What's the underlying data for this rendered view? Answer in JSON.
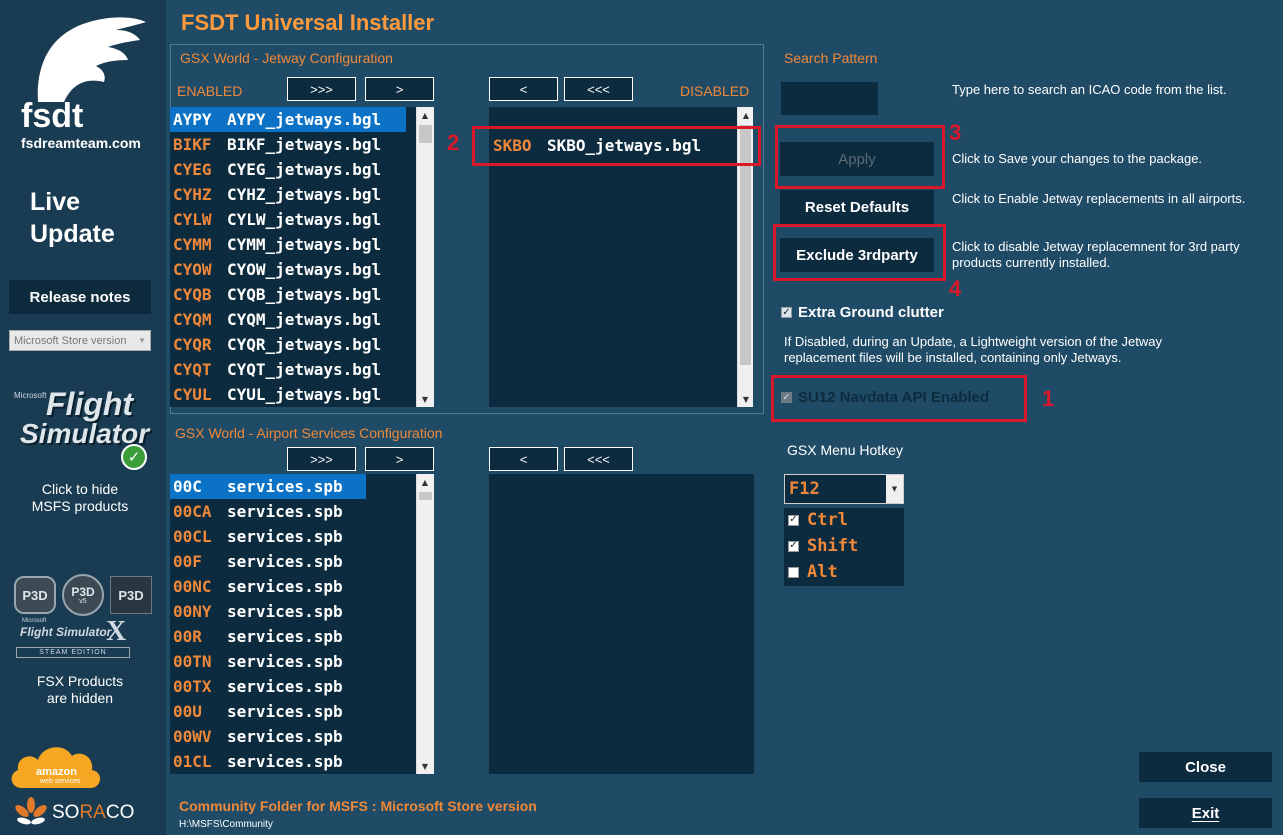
{
  "sidebar": {
    "logo_text": "fsdt",
    "logo_site": "fsdreamteam.com",
    "live_update_line1": "Live",
    "live_update_line2": "Update",
    "release_notes": "Release notes",
    "store_select": "Microsoft Store version",
    "msfs_caption_line1": "Click to hide",
    "msfs_caption_line2": "MSFS products",
    "msfs_logo_line1": "Flight",
    "msfs_logo_line2": "Simulator",
    "msfs_logo_small": "Microsoft",
    "p3d_labels": [
      "P3D",
      "P3D",
      "P3D"
    ],
    "p3d_v5": "v5",
    "fsx_logo_small": "Microsoft",
    "fsx_logo_text": "Flight Simulator",
    "fsx_logo_x": "X",
    "fsx_logo_steam": "STEAM EDITION",
    "fsx_caption_line1": "FSX Products",
    "fsx_caption_line2": "are hidden",
    "aws_label": "amazon",
    "aws_sub": "web services",
    "soraco_pre": "SO",
    "soraco_mid": "RA",
    "soraco_post": "CO"
  },
  "main": {
    "title": "FSDT Universal Installer",
    "jetway_section": "GSX World - Jetway Configuration",
    "enabled_label": "ENABLED",
    "disabled_label": "DISABLED",
    "btn_add_all": ">>>",
    "btn_add": ">",
    "btn_remove": "<",
    "btn_remove_all": "<<<",
    "jetway_enabled": [
      {
        "code": "AYPY",
        "file": "AYPY_jetways.bgl"
      },
      {
        "code": "BIKF",
        "file": "BIKF_jetways.bgl"
      },
      {
        "code": "CYEG",
        "file": "CYEG_jetways.bgl"
      },
      {
        "code": "CYHZ",
        "file": "CYHZ_jetways.bgl"
      },
      {
        "code": "CYLW",
        "file": "CYLW_jetways.bgl"
      },
      {
        "code": "CYMM",
        "file": "CYMM_jetways.bgl"
      },
      {
        "code": "CYOW",
        "file": "CYOW_jetways.bgl"
      },
      {
        "code": "CYQB",
        "file": "CYQB_jetways.bgl"
      },
      {
        "code": "CYQM",
        "file": "CYQM_jetways.bgl"
      },
      {
        "code": "CYQR",
        "file": "CYQR_jetways.bgl"
      },
      {
        "code": "CYQT",
        "file": "CYQT_jetways.bgl"
      },
      {
        "code": "CYUL",
        "file": "CYUL_jetways.bgl"
      }
    ],
    "jetway_disabled": [
      {
        "code": "SKBO",
        "file": "SKBO_jetways.bgl"
      }
    ],
    "services_section": "GSX World - Airport Services Configuration",
    "services_enabled": [
      {
        "code": "00C",
        "file": "services.spb"
      },
      {
        "code": "00CA",
        "file": "services.spb"
      },
      {
        "code": "00CL",
        "file": "services.spb"
      },
      {
        "code": "00F",
        "file": "services.spb"
      },
      {
        "code": "00NC",
        "file": "services.spb"
      },
      {
        "code": "00NY",
        "file": "services.spb"
      },
      {
        "code": "00R",
        "file": "services.spb"
      },
      {
        "code": "00TN",
        "file": "services.spb"
      },
      {
        "code": "00TX",
        "file": "services.spb"
      },
      {
        "code": "00U",
        "file": "services.spb"
      },
      {
        "code": "00WV",
        "file": "services.spb"
      },
      {
        "code": "01CL",
        "file": "services.spb"
      }
    ],
    "search_pattern_label": "Search Pattern",
    "search_value": "",
    "search_help": "Type here to search an ICAO code from the list.",
    "apply_label": "Apply",
    "apply_help": "Click to Save your changes to the package.",
    "reset_label": "Reset Defaults",
    "reset_help": "Click to Enable Jetway replacements in all airports.",
    "exclude_label": "Exclude 3rdparty",
    "exclude_help": "Click to disable Jetway replacemnent for 3rd party products currently installed.",
    "ground_clutter_label": "Extra Ground clutter",
    "ground_clutter_checked": true,
    "ground_clutter_help": "If Disabled, during an Update, a Lightweight version of the Jetway replacement files will be installed, containing only Jetways.",
    "su12_label": "SU12 Navdata API Enabled",
    "su12_checked": true,
    "hotkey_label": "GSX Menu Hotkey",
    "hotkey_value": "F12",
    "mod_ctrl": "Ctrl",
    "mod_shift": "Shift",
    "mod_alt": "Alt",
    "mod_ctrl_checked": true,
    "mod_shift_checked": true,
    "mod_alt_checked": false,
    "close_label": "Close",
    "exit_label": "Exit",
    "community_label": "Community Folder for MSFS : Microsoft Store version",
    "community_path": "H:\\MSFS\\Community"
  },
  "annotations": [
    "1",
    "2",
    "3",
    "4"
  ],
  "colors": {
    "accent_orange": "#f0883a",
    "title_orange": "#ff9a3c",
    "annotation_red": "#d9182a",
    "background": "#1f4b66",
    "list_bg": "#0d2b3e",
    "selected": "#0b72c6"
  }
}
